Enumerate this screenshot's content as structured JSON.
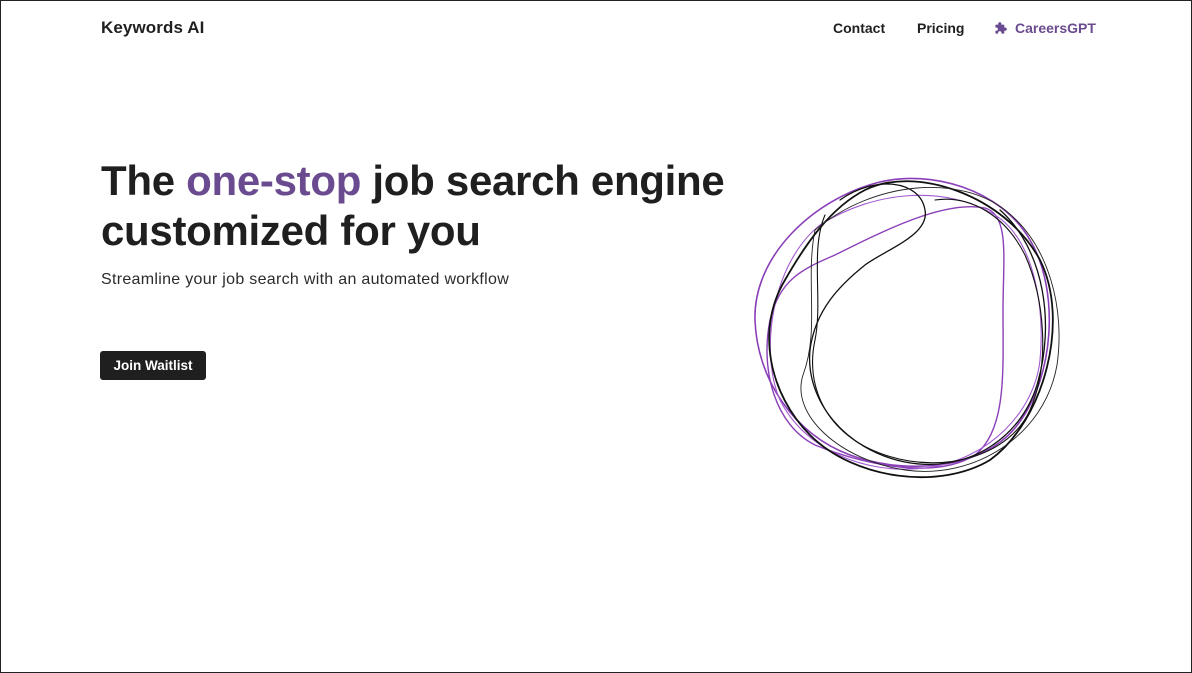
{
  "header": {
    "brand": "Keywords AI",
    "nav": {
      "contact": "Contact",
      "pricing": "Pricing",
      "careers": "CareersGPT",
      "careers_icon": "puzzle-piece-icon"
    }
  },
  "hero": {
    "headline_prefix": "The ",
    "headline_accent": "one-stop",
    "headline_line1_suffix": " job search engine",
    "headline_line2": "customized for you",
    "subtitle": "Streamline your job search with an automated workflow",
    "cta_label": "Join Waitlist"
  },
  "colors": {
    "accent": "#6a4b8f",
    "text": "#1f1f1f",
    "button_bg": "#1f1f1f",
    "button_text": "#ffffff",
    "blob_purple": "#8a3fb8",
    "blob_black": "#111111"
  },
  "decoration": {
    "icon": "abstract-loops-illustration"
  }
}
